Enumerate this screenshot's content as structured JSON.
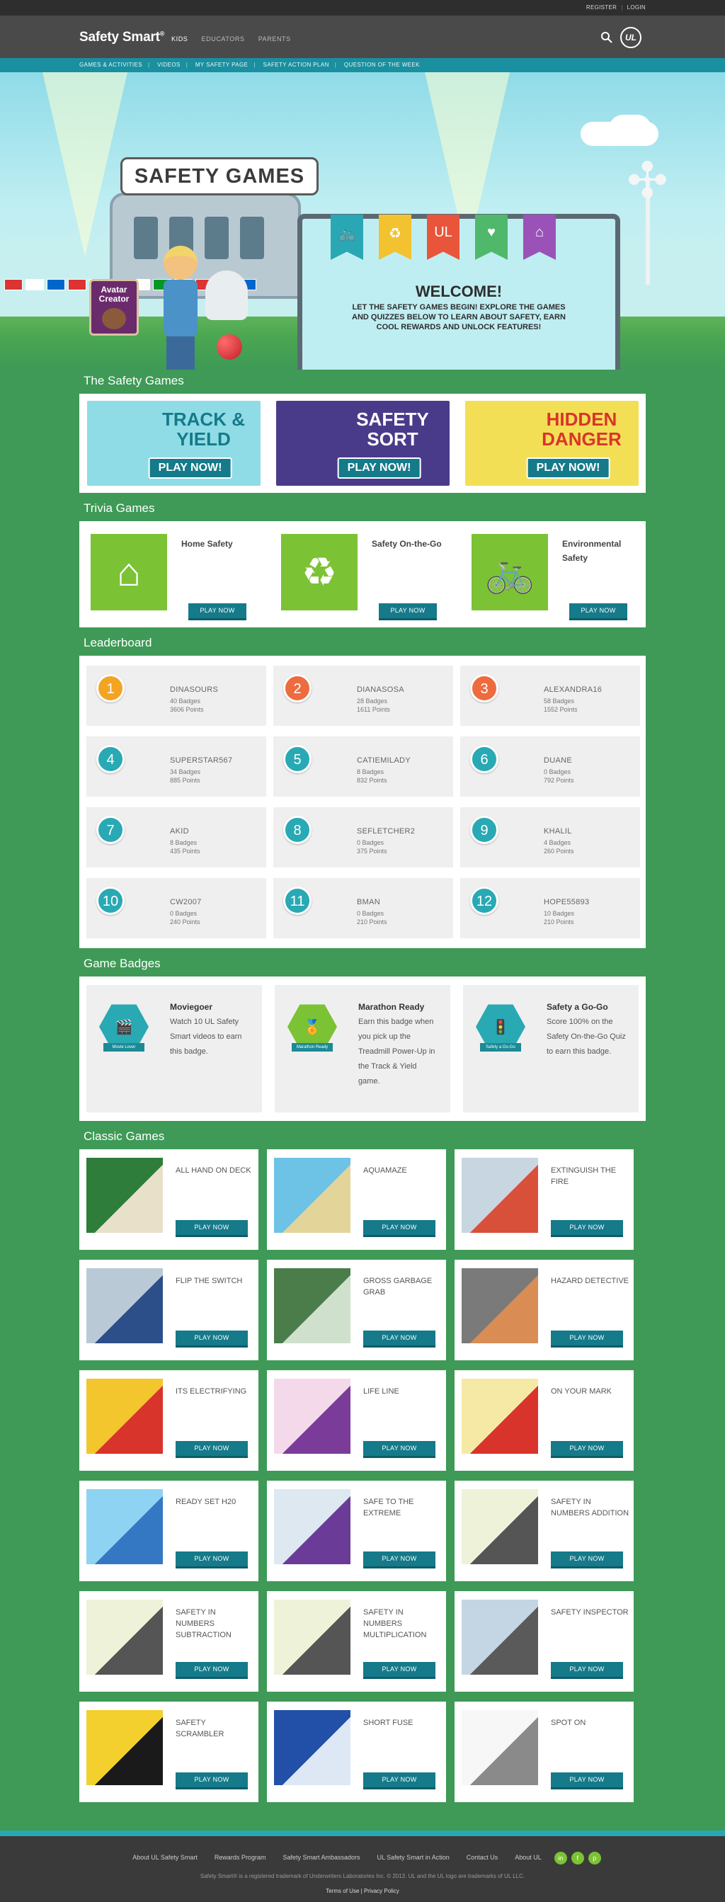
{
  "topbar": {
    "register": "REGISTER",
    "separator": "|",
    "login": "LOGIN"
  },
  "header": {
    "brand": "Safety Smart",
    "brand_mark": "®",
    "nav": [
      "KIDS",
      "EDUCATORS",
      "PARENTS"
    ],
    "logo_text": "UL"
  },
  "subnav": [
    "GAMES & ACTIVITIES",
    "VIDEOS",
    "MY SAFETY PAGE",
    "SAFETY ACTION PLAN",
    "QUESTION OF THE WEEK"
  ],
  "hero": {
    "banner": "SAFETY GAMES",
    "avatar_label": "Avatar Creator",
    "welcome_title": "WELCOME!",
    "welcome_text": "LET THE SAFETY GAMES BEGIN! EXPLORE THE GAMES AND QUIZZES BELOW TO LEARN ABOUT SAFETY, EARN COOL REWARDS AND UNLOCK FEATURES!",
    "ribbons": [
      {
        "icon": "bicycle-icon",
        "glyph": "🚲",
        "color": "#2aa7b4"
      },
      {
        "icon": "recycle-icon",
        "glyph": "♻",
        "color": "#f2c230"
      },
      {
        "icon": "ul-icon",
        "glyph": "UL",
        "color": "#e8553a"
      },
      {
        "icon": "heart-icon",
        "glyph": "♥",
        "color": "#4fb86a"
      },
      {
        "icon": "house-icon",
        "glyph": "⌂",
        "color": "#9a52b8"
      }
    ]
  },
  "sections": {
    "safety_games": "The Safety Games",
    "trivia": "Trivia Games",
    "leaderboard": "Leaderboard",
    "badges": "Game Badges",
    "classic": "Classic Games"
  },
  "safety_games": [
    {
      "name": "TRACK & YIELD",
      "cta": "PLAY NOW!",
      "bg": "#8fdce6",
      "fg": "#157a8a"
    },
    {
      "name": "SAFETY SORT",
      "cta": "PLAY NOW!",
      "bg": "#4a3b8a",
      "fg": "#ffffff"
    },
    {
      "name": "HIDDEN DANGER",
      "cta": "PLAY NOW!",
      "bg": "#f3df56",
      "fg": "#d9342b"
    }
  ],
  "trivia": [
    {
      "name": "Home Safety",
      "icon": "house-icon",
      "glyph": "⌂",
      "cta": "PLAY NOW"
    },
    {
      "name": "Safety On-the-Go",
      "icon": "recycle-icon",
      "glyph": "♻",
      "cta": "PLAY NOW"
    },
    {
      "name": "Environmental Safety",
      "icon": "bicycle-icon",
      "glyph": "🚲",
      "cta": "PLAY NOW"
    }
  ],
  "leaderboard": [
    {
      "rank": "1",
      "name": "DINASOURS",
      "badges": "40 Badges",
      "points": "3606 Points",
      "color": "#f3a423"
    },
    {
      "rank": "2",
      "name": "DIANASOSA",
      "badges": "28 Badges",
      "points": "1611 Points",
      "color": "#ee6b3f"
    },
    {
      "rank": "3",
      "name": "ALEXANDRA16",
      "badges": "58 Badges",
      "points": "1552 Points",
      "color": "#ee6b3f"
    },
    {
      "rank": "4",
      "name": "SUPERSTAR567",
      "badges": "34 Badges",
      "points": "885 Points",
      "color": "#29a9b4"
    },
    {
      "rank": "5",
      "name": "CATIEMILADY",
      "badges": "8 Badges",
      "points": "832 Points",
      "color": "#29a9b4"
    },
    {
      "rank": "6",
      "name": "DUANE",
      "badges": "0 Badges",
      "points": "792 Points",
      "color": "#29a9b4"
    },
    {
      "rank": "7",
      "name": "AKID",
      "badges": "8 Badges",
      "points": "435 Points",
      "color": "#29a9b4"
    },
    {
      "rank": "8",
      "name": "SEFLETCHER2",
      "badges": "0 Badges",
      "points": "375 Points",
      "color": "#29a9b4"
    },
    {
      "rank": "9",
      "name": "KHALIL",
      "badges": "4 Badges",
      "points": "260 Points",
      "color": "#29a9b4"
    },
    {
      "rank": "10",
      "name": "CW2007",
      "badges": "0 Badges",
      "points": "240 Points",
      "color": "#29a9b4"
    },
    {
      "rank": "11",
      "name": "BMAN",
      "badges": "0 Badges",
      "points": "210 Points",
      "color": "#29a9b4"
    },
    {
      "rank": "12",
      "name": "HOPE55893",
      "badges": "10 Badges",
      "points": "210 Points",
      "color": "#29a9b4"
    }
  ],
  "badges": [
    {
      "name": "Moviegoer",
      "desc": "Watch 10 UL Safety Smart videos to earn this badge.",
      "label": "Movie Lover",
      "icon": "film-icon",
      "glyph": "🎬",
      "color": "#29a9b4"
    },
    {
      "name": "Marathon Ready",
      "desc": "Earn this badge when you pick up the Treadmill Power-Up in the Track & Yield game.",
      "label": "Marathon Ready",
      "icon": "medal-icon",
      "glyph": "🏅",
      "color": "#7bc234"
    },
    {
      "name": "Safety a Go-Go",
      "desc": "Score 100% on the Safety On-the-Go Quiz to earn this badge.",
      "label": "Safety a Go-Go",
      "icon": "traffic-light-icon",
      "glyph": "🚦",
      "color": "#29a9b4"
    }
  ],
  "classic_games": [
    {
      "name": "ALL HAND ON DECK",
      "cta": "PLAY NOW",
      "c1": "#2e7d3a",
      "c2": "#e8e0c8"
    },
    {
      "name": "AQUAMAZE",
      "cta": "PLAY NOW",
      "c1": "#6cc3e6",
      "c2": "#e3d49a"
    },
    {
      "name": "EXTINGUISH THE FIRE",
      "cta": "PLAY NOW",
      "c1": "#c7d6e0",
      "c2": "#d9503a"
    },
    {
      "name": "FLIP THE SWITCH",
      "cta": "PLAY NOW",
      "c1": "#b9cad6",
      "c2": "#2c4f8a"
    },
    {
      "name": "GROSS GARBAGE GRAB",
      "cta": "PLAY NOW",
      "c1": "#4a7d4a",
      "c2": "#cfe0cc"
    },
    {
      "name": "HAZARD DETECTIVE",
      "cta": "PLAY NOW",
      "c1": "#7a7a7a",
      "c2": "#d98d54"
    },
    {
      "name": "ITS ELECTRIFYING",
      "cta": "PLAY NOW",
      "c1": "#f3c62e",
      "c2": "#d9342b"
    },
    {
      "name": "LIFE LINE",
      "cta": "PLAY NOW",
      "c1": "#f4d9ea",
      "c2": "#7a3c98"
    },
    {
      "name": "ON YOUR MARK",
      "cta": "PLAY NOW",
      "c1": "#f6e9a6",
      "c2": "#d9342b"
    },
    {
      "name": "READY SET H20",
      "cta": "PLAY NOW",
      "c1": "#8fd3f2",
      "c2": "#3478c4"
    },
    {
      "name": "SAFE TO THE EXTREME",
      "cta": "PLAY NOW",
      "c1": "#dde8f0",
      "c2": "#6a3c98"
    },
    {
      "name": "SAFETY IN NUMBERS ADDITION",
      "cta": "PLAY NOW",
      "c1": "#eef2d8",
      "c2": "#555555"
    },
    {
      "name": "SAFETY IN NUMBERS SUBTRACTION",
      "cta": "PLAY NOW",
      "c1": "#eef2d8",
      "c2": "#555555"
    },
    {
      "name": "SAFETY IN NUMBERS MULTIPLICATION",
      "cta": "PLAY NOW",
      "c1": "#eef2d8",
      "c2": "#555555"
    },
    {
      "name": "SAFETY INSPECTOR",
      "cta": "PLAY NOW",
      "c1": "#c4d6e4",
      "c2": "#5a5a5a"
    },
    {
      "name": "SAFETY SCRAMBLER",
      "cta": "PLAY NOW",
      "c1": "#f3d02e",
      "c2": "#1a1a1a"
    },
    {
      "name": "SHORT FUSE",
      "cta": "PLAY NOW",
      "c1": "#2250a8",
      "c2": "#dde8f4"
    },
    {
      "name": "SPOT ON",
      "cta": "PLAY NOW",
      "c1": "#f7f7f7",
      "c2": "#8a8a8a"
    }
  ],
  "footer": {
    "links": [
      "About UL Safety Smart",
      "Rewards Program",
      "Safety Smart Ambassadors",
      "UL Safety Smart in Action",
      "Contact Us",
      "About UL"
    ],
    "social": [
      {
        "icon": "linkedin-icon",
        "glyph": "in"
      },
      {
        "icon": "facebook-icon",
        "glyph": "f"
      },
      {
        "icon": "pinterest-icon",
        "glyph": "p"
      }
    ],
    "copyright": "Safety Smart® is a registered trademark of Underwriters Laboratories Inc. © 2013. UL and the UL logo are trademarks of UL LLC.",
    "terms": "Terms of Use",
    "divider": "|",
    "privacy": "Privacy Policy"
  }
}
